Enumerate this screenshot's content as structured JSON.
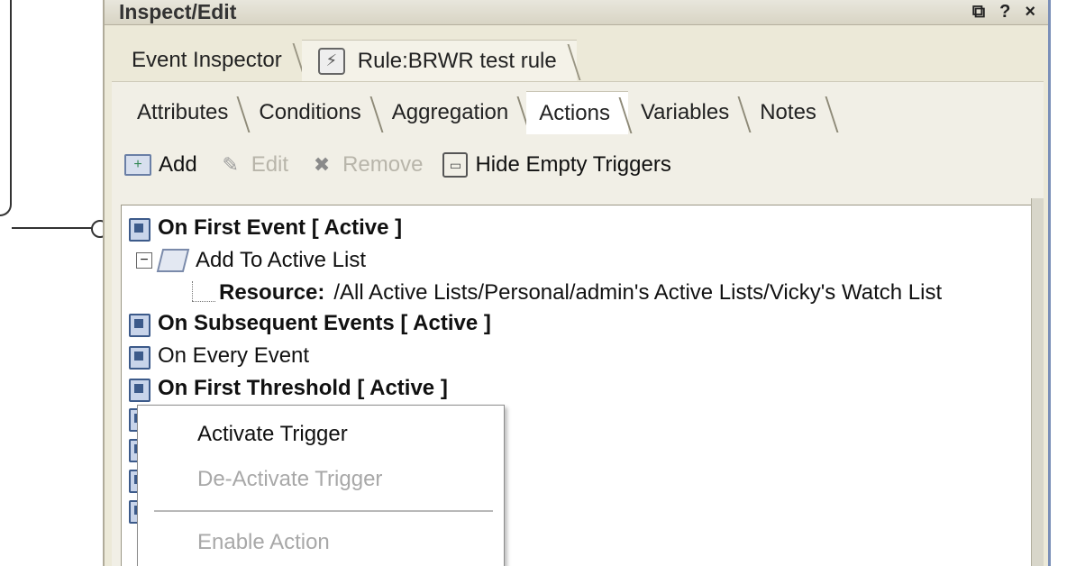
{
  "window": {
    "title": "Inspect/Edit",
    "icons": [
      "restore-icon",
      "help-icon",
      "close-icon"
    ],
    "restore_glyph": "⧉",
    "help_glyph": "?",
    "close_glyph": "×"
  },
  "outer_tabs": [
    {
      "label": "Event Inspector"
    },
    {
      "label": "Rule:BRWR test rule",
      "icon": "bolt-icon",
      "glyph": "⚡",
      "active": true
    }
  ],
  "inner_tabs": [
    {
      "label": "Attributes"
    },
    {
      "label": "Conditions"
    },
    {
      "label": "Aggregation"
    },
    {
      "label": "Actions",
      "active": true
    },
    {
      "label": "Variables"
    },
    {
      "label": "Notes"
    }
  ],
  "toolbar": {
    "add_label": "Add",
    "edit_label": "Edit",
    "remove_label": "Remove",
    "hide_label": "Hide Empty Triggers",
    "add_glyph": "+",
    "edit_glyph": "✎",
    "remove_glyph": "✖",
    "hide_glyph": "▭"
  },
  "tree": {
    "on_first_event": "On First Event [ Active ]",
    "collapse_glyph": "−",
    "add_to_active_list": "Add To Active List",
    "resource_label": "Resource:",
    "resource_value": "/All Active Lists/Personal/admin's Active Lists/Vicky's Watch List",
    "on_subsequent_events": "On Subsequent Events [ Active ]",
    "on_every_event": "On Every Event",
    "on_first_threshold": "On First Threshold [ Active ]"
  },
  "context_menu": {
    "activate_trigger": "Activate Trigger",
    "deactivate_trigger": "De-Activate Trigger",
    "enable_action": "Enable Action"
  }
}
